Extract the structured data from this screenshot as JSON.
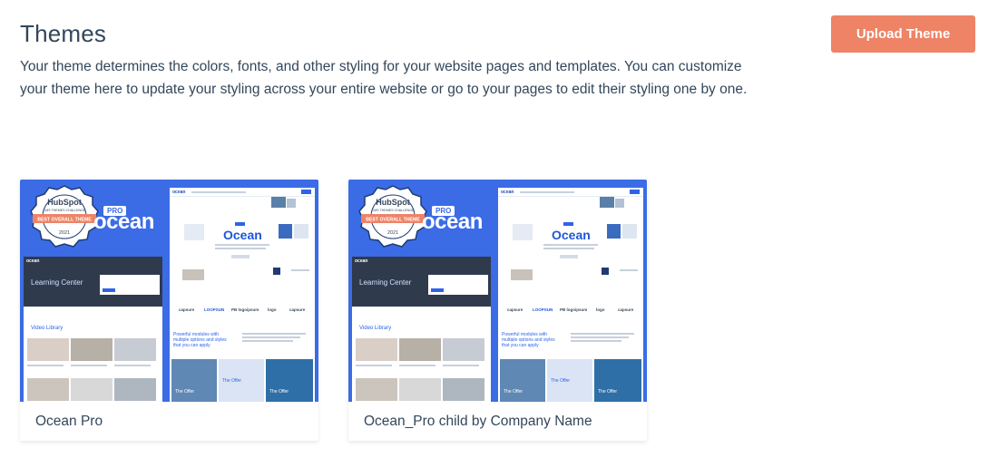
{
  "header": {
    "title": "Themes",
    "upload_label": "Upload Theme",
    "description": "Your theme determines the colors, fonts, and other styling for your website pages and templates. You can customize your theme here to update your styling across your entire website or go to your pages to edit their styling one by one."
  },
  "themes": [
    {
      "name": "Ocean Pro"
    },
    {
      "name": "Ocean_Pro child by Company Name"
    }
  ],
  "thumbnail": {
    "badge_brand": "HubSpot",
    "badge_line1": "CMS THEMES CHALLENGE",
    "badge_ribbon": "BEST OVERALL THEME",
    "badge_year": "2021",
    "pro_tag": "PRO",
    "logo_word": "ocean",
    "preview_logo": "ocean",
    "preview_heading": "Ocean",
    "learning_center": "Learning Center",
    "video_library": "Video Library",
    "powerful_text": "Powerful modules with multiple options and styles that you can apply",
    "offer_label": "The Offer",
    "partner_logos": [
      "capsure",
      "LOOPSUN",
      "PB logoipsum",
      "logo",
      "capsure"
    ]
  },
  "colors": {
    "accent": "#ee8366",
    "theme_blue": "#3b6ce6",
    "text": "#33475b"
  }
}
